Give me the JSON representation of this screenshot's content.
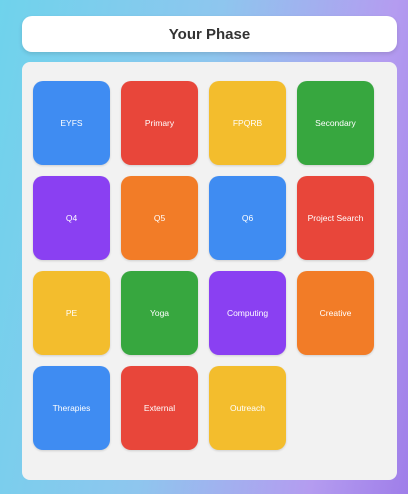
{
  "header": {
    "title": "Your Phase"
  },
  "colors": {
    "blue": "#3f8cf2",
    "red": "#e8463a",
    "yellow": "#f3bd2d",
    "green": "#37a73f",
    "purple": "#8a40f2",
    "orange": "#f27c27"
  },
  "tiles": [
    {
      "label": "EYFS",
      "color": "#3f8cf2"
    },
    {
      "label": "Primary",
      "color": "#e8463a"
    },
    {
      "label": "FPQRB",
      "color": "#f3bd2d"
    },
    {
      "label": "Secondary",
      "color": "#37a73f"
    },
    {
      "label": "Q4",
      "color": "#8a40f2"
    },
    {
      "label": "Q5",
      "color": "#f27c27"
    },
    {
      "label": "Q6",
      "color": "#3f8cf2"
    },
    {
      "label": "Project Search",
      "color": "#e8463a"
    },
    {
      "label": "PE",
      "color": "#f3bd2d"
    },
    {
      "label": "Yoga",
      "color": "#37a73f"
    },
    {
      "label": "Computing",
      "color": "#8a40f2"
    },
    {
      "label": "Creative",
      "color": "#f27c27"
    },
    {
      "label": "Therapies",
      "color": "#3f8cf2"
    },
    {
      "label": "External",
      "color": "#e8463a"
    },
    {
      "label": "Outreach",
      "color": "#f3bd2d"
    }
  ]
}
